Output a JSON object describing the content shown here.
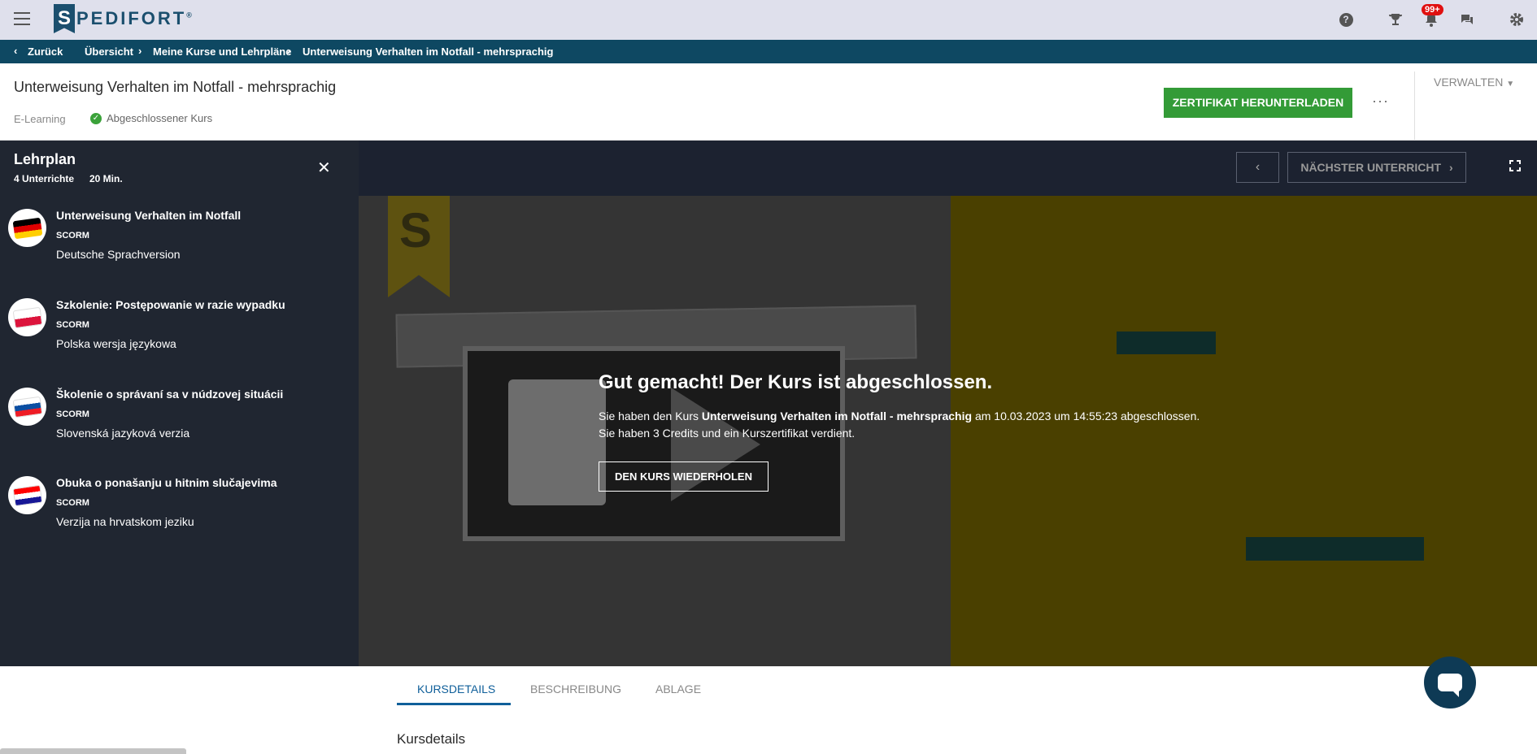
{
  "app": {
    "logo_text": "PEDIFORT",
    "logo_letter": "S",
    "logo_mark": "®",
    "notification_count": "99+"
  },
  "breadcrumb": {
    "back": "Zurück",
    "items": [
      "Übersicht",
      "Meine Kurse und Lehrpläne",
      "Unterweisung Verhalten im Notfall - mehrsprachig"
    ]
  },
  "header": {
    "title": "Unterweisung Verhalten im Notfall - mehrsprachig",
    "type": "E-Learning",
    "status": "Abgeschlossener Kurs",
    "certificate_button": "ZERTIFIKAT HERUNTERLADEN",
    "more": "···",
    "manage": "VERWALTEN"
  },
  "sidebar": {
    "title": "Lehrplan",
    "count": "4 Unterrichte",
    "duration": "20 Min.",
    "lessons": [
      {
        "title": "Unterweisung Verhalten im Notfall",
        "type": "SCORM",
        "desc": "Deutsche Sprachversion",
        "flag": "de"
      },
      {
        "title": "Szkolenie: Postępowanie w razie wypadku",
        "type": "SCORM",
        "desc": "Polska wersja językowa",
        "flag": "pl"
      },
      {
        "title": "Školenie o správaní sa v núdzovej situácii",
        "type": "SCORM",
        "desc": "Slovenská jazyková verzia",
        "flag": "sk"
      },
      {
        "title": "Obuka o ponašanju u hitnim slučajevima",
        "type": "SCORM",
        "desc": "Verzija na hrvatskom jeziku",
        "flag": "hr"
      }
    ]
  },
  "player": {
    "next_button": "NÄCHSTER UNTERRICHT",
    "done_title": "Gut gemacht! Der Kurs ist abgeschlossen.",
    "done_pre": "Sie haben den Kurs ",
    "done_course": "Unterweisung Verhalten im Notfall - mehrsprachig",
    "done_post": " am 10.03.2023 um 14:55:23 abgeschlossen.",
    "done_line2": "Sie haben 3 Credits und ein Kurszertifikat verdient.",
    "repeat_button": "DEN KURS WIEDERHOLEN"
  },
  "tabs": [
    "KURSDETAILS",
    "BESCHREIBUNG",
    "ABLAGE"
  ],
  "section_title": "Kursdetails",
  "colors": {
    "primary": "#0e4862",
    "success": "#339b37",
    "sidebar": "#202631",
    "tab_active": "#0f5f9a"
  }
}
